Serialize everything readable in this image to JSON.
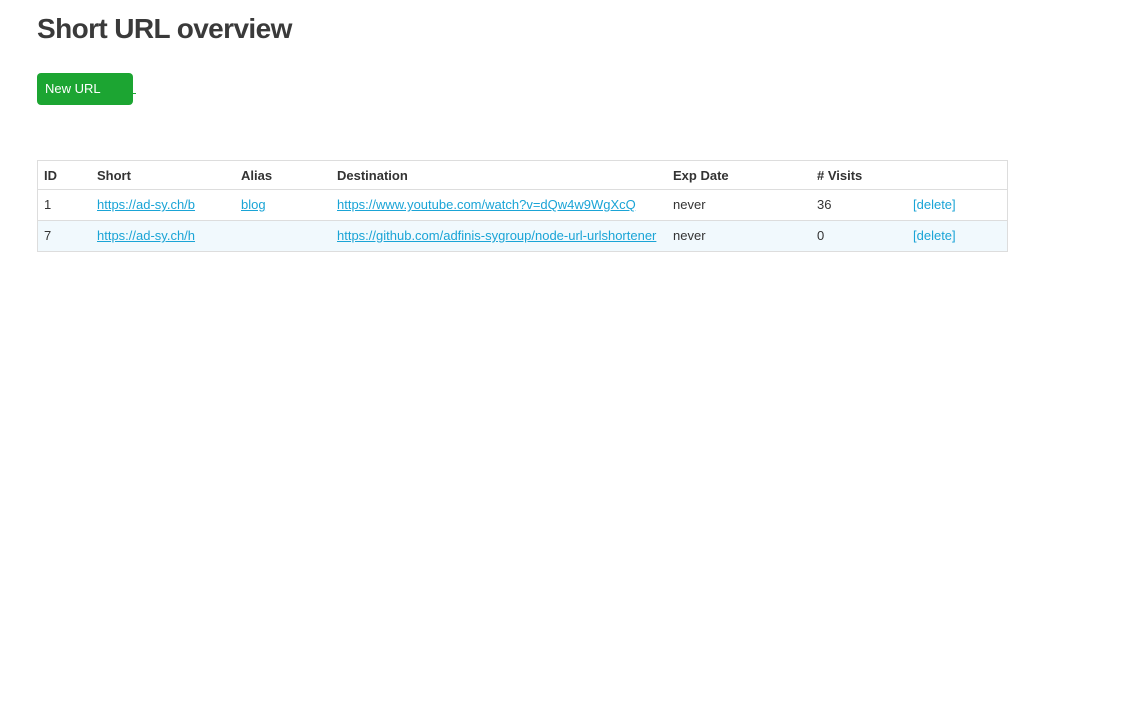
{
  "page": {
    "title": "Short URL overview"
  },
  "toolbar": {
    "new_url_label": "New URL",
    "new_url_color": "#1ca532"
  },
  "table": {
    "headers": {
      "id": "ID",
      "short": "Short",
      "alias": "Alias",
      "destination": "Destination",
      "exp_date": "Exp Date",
      "visits": "# Visits",
      "actions": ""
    },
    "rows": [
      {
        "id": "1",
        "short": "https://ad-sy.ch/b",
        "alias": "blog",
        "destination": "https://www.youtube.com/watch?v=dQw4w9WgXcQ",
        "exp_date": "never",
        "visits": "36",
        "action": "[delete]"
      },
      {
        "id": "7",
        "short": "https://ad-sy.ch/h",
        "alias": "",
        "destination": "https://github.com/adfinis-sygroup/node-url-urlshortener",
        "exp_date": "never",
        "visits": "0",
        "action": "[delete]"
      }
    ]
  },
  "colors": {
    "link": "#1aa4d6",
    "row_alt": "#f1f9fd",
    "border": "#dddddd"
  }
}
